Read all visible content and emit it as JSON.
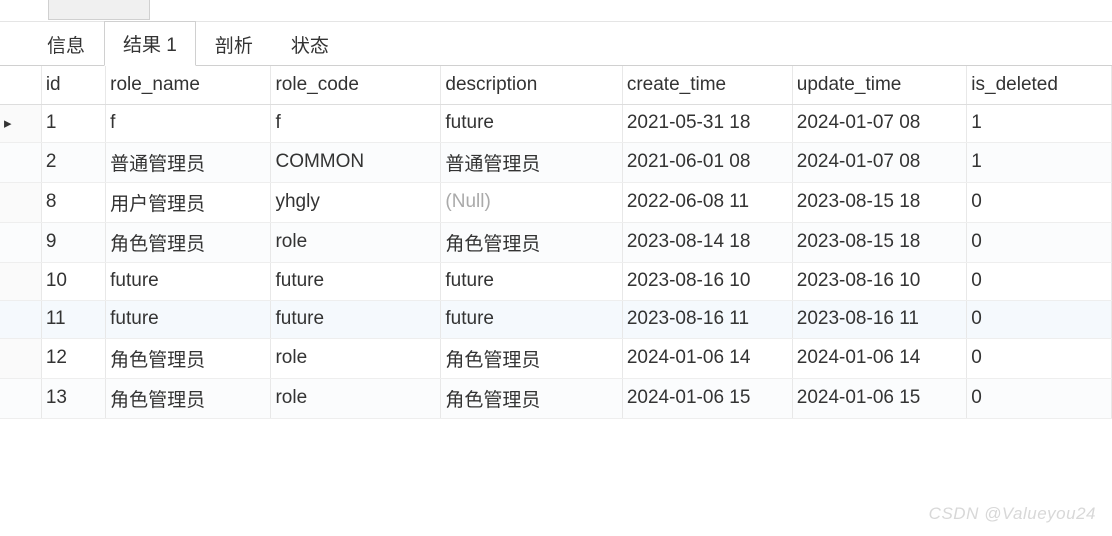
{
  "tabs": {
    "items": [
      {
        "label": "信息",
        "active": false
      },
      {
        "label": "结果 1",
        "active": true
      },
      {
        "label": "剖析",
        "active": false
      },
      {
        "label": "状态",
        "active": false
      }
    ]
  },
  "columns": {
    "id": "id",
    "role_name": "role_name",
    "role_code": "role_code",
    "description": "description",
    "create_time": "create_time",
    "update_time": "update_time",
    "is_deleted": "is_deleted"
  },
  "rows": [
    {
      "indicator": "▸",
      "id": "1",
      "role_name": "f",
      "role_code": "f",
      "description": "future",
      "create_time": "2021-05-31 18",
      "update_time": "2024-01-07 08",
      "is_deleted": "1",
      "null_desc": false
    },
    {
      "indicator": "",
      "id": "2",
      "role_name": "普通管理员",
      "role_code": "COMMON",
      "description": "普通管理员",
      "create_time": "2021-06-01 08",
      "update_time": "2024-01-07 08",
      "is_deleted": "1",
      "null_desc": false
    },
    {
      "indicator": "",
      "id": "8",
      "role_name": "用户管理员",
      "role_code": "yhgly",
      "description": "(Null)",
      "create_time": "2022-06-08 11",
      "update_time": "2023-08-15 18",
      "is_deleted": "0",
      "null_desc": true
    },
    {
      "indicator": "",
      "id": "9",
      "role_name": "角色管理员",
      "role_code": "role",
      "description": "角色管理员",
      "create_time": "2023-08-14 18",
      "update_time": "2023-08-15 18",
      "is_deleted": "0",
      "null_desc": false
    },
    {
      "indicator": "",
      "id": "10",
      "role_name": "future",
      "role_code": "future",
      "description": "future",
      "create_time": "2023-08-16 10",
      "update_time": "2023-08-16 10",
      "is_deleted": "0",
      "null_desc": false
    },
    {
      "indicator": "",
      "id": "11",
      "role_name": "future",
      "role_code": "future",
      "description": "future",
      "create_time": "2023-08-16 11",
      "update_time": "2023-08-16 11",
      "is_deleted": "0",
      "null_desc": false
    },
    {
      "indicator": "",
      "id": "12",
      "role_name": "角色管理员",
      "role_code": "role",
      "description": "角色管理员",
      "create_time": "2024-01-06 14",
      "update_time": "2024-01-06 14",
      "is_deleted": "0",
      "null_desc": false
    },
    {
      "indicator": "",
      "id": "13",
      "role_name": "角色管理员",
      "role_code": "role",
      "description": "角色管理员",
      "create_time": "2024-01-06 15",
      "update_time": "2024-01-06 15",
      "is_deleted": "0",
      "null_desc": false
    }
  ],
  "watermark": "CSDN @Valueyou24"
}
